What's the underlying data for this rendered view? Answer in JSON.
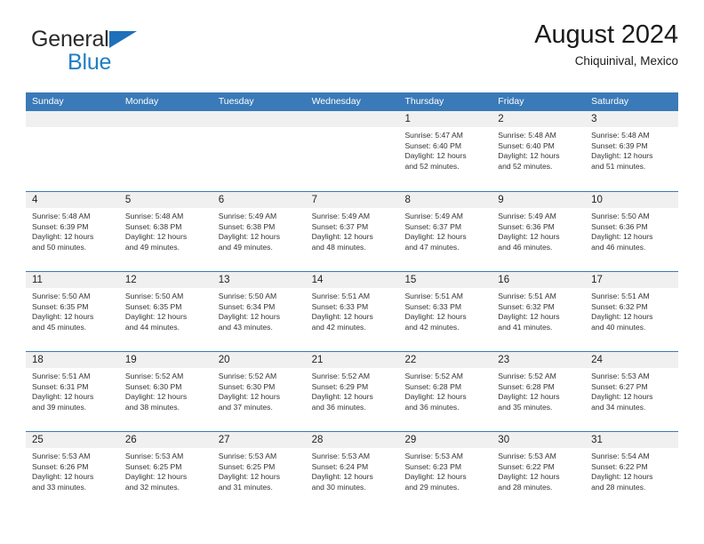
{
  "brand": {
    "name_part1": "General",
    "name_part2": "Blue",
    "triangle_color": "#1f6fba",
    "blue_color": "#1f7ec4"
  },
  "header": {
    "month_title": "August 2024",
    "location": "Chiquinival, Mexico"
  },
  "theme": {
    "header_blue": "#3a7ab8",
    "daynum_band": "#f0f0f0",
    "text": "#333333"
  },
  "weekday_headers": [
    "Sunday",
    "Monday",
    "Tuesday",
    "Wednesday",
    "Thursday",
    "Friday",
    "Saturday"
  ],
  "weeks": [
    [
      {
        "day": "",
        "empty": true
      },
      {
        "day": "",
        "empty": true
      },
      {
        "day": "",
        "empty": true
      },
      {
        "day": "",
        "empty": true
      },
      {
        "day": "1",
        "sunrise": "Sunrise: 5:47 AM",
        "sunset": "Sunset: 6:40 PM",
        "daylight_l1": "Daylight: 12 hours",
        "daylight_l2": "and 52 minutes."
      },
      {
        "day": "2",
        "sunrise": "Sunrise: 5:48 AM",
        "sunset": "Sunset: 6:40 PM",
        "daylight_l1": "Daylight: 12 hours",
        "daylight_l2": "and 52 minutes."
      },
      {
        "day": "3",
        "sunrise": "Sunrise: 5:48 AM",
        "sunset": "Sunset: 6:39 PM",
        "daylight_l1": "Daylight: 12 hours",
        "daylight_l2": "and 51 minutes."
      }
    ],
    [
      {
        "day": "4",
        "sunrise": "Sunrise: 5:48 AM",
        "sunset": "Sunset: 6:39 PM",
        "daylight_l1": "Daylight: 12 hours",
        "daylight_l2": "and 50 minutes."
      },
      {
        "day": "5",
        "sunrise": "Sunrise: 5:48 AM",
        "sunset": "Sunset: 6:38 PM",
        "daylight_l1": "Daylight: 12 hours",
        "daylight_l2": "and 49 minutes."
      },
      {
        "day": "6",
        "sunrise": "Sunrise: 5:49 AM",
        "sunset": "Sunset: 6:38 PM",
        "daylight_l1": "Daylight: 12 hours",
        "daylight_l2": "and 49 minutes."
      },
      {
        "day": "7",
        "sunrise": "Sunrise: 5:49 AM",
        "sunset": "Sunset: 6:37 PM",
        "daylight_l1": "Daylight: 12 hours",
        "daylight_l2": "and 48 minutes."
      },
      {
        "day": "8",
        "sunrise": "Sunrise: 5:49 AM",
        "sunset": "Sunset: 6:37 PM",
        "daylight_l1": "Daylight: 12 hours",
        "daylight_l2": "and 47 minutes."
      },
      {
        "day": "9",
        "sunrise": "Sunrise: 5:49 AM",
        "sunset": "Sunset: 6:36 PM",
        "daylight_l1": "Daylight: 12 hours",
        "daylight_l2": "and 46 minutes."
      },
      {
        "day": "10",
        "sunrise": "Sunrise: 5:50 AM",
        "sunset": "Sunset: 6:36 PM",
        "daylight_l1": "Daylight: 12 hours",
        "daylight_l2": "and 46 minutes."
      }
    ],
    [
      {
        "day": "11",
        "sunrise": "Sunrise: 5:50 AM",
        "sunset": "Sunset: 6:35 PM",
        "daylight_l1": "Daylight: 12 hours",
        "daylight_l2": "and 45 minutes."
      },
      {
        "day": "12",
        "sunrise": "Sunrise: 5:50 AM",
        "sunset": "Sunset: 6:35 PM",
        "daylight_l1": "Daylight: 12 hours",
        "daylight_l2": "and 44 minutes."
      },
      {
        "day": "13",
        "sunrise": "Sunrise: 5:50 AM",
        "sunset": "Sunset: 6:34 PM",
        "daylight_l1": "Daylight: 12 hours",
        "daylight_l2": "and 43 minutes."
      },
      {
        "day": "14",
        "sunrise": "Sunrise: 5:51 AM",
        "sunset": "Sunset: 6:33 PM",
        "daylight_l1": "Daylight: 12 hours",
        "daylight_l2": "and 42 minutes."
      },
      {
        "day": "15",
        "sunrise": "Sunrise: 5:51 AM",
        "sunset": "Sunset: 6:33 PM",
        "daylight_l1": "Daylight: 12 hours",
        "daylight_l2": "and 42 minutes."
      },
      {
        "day": "16",
        "sunrise": "Sunrise: 5:51 AM",
        "sunset": "Sunset: 6:32 PM",
        "daylight_l1": "Daylight: 12 hours",
        "daylight_l2": "and 41 minutes."
      },
      {
        "day": "17",
        "sunrise": "Sunrise: 5:51 AM",
        "sunset": "Sunset: 6:32 PM",
        "daylight_l1": "Daylight: 12 hours",
        "daylight_l2": "and 40 minutes."
      }
    ],
    [
      {
        "day": "18",
        "sunrise": "Sunrise: 5:51 AM",
        "sunset": "Sunset: 6:31 PM",
        "daylight_l1": "Daylight: 12 hours",
        "daylight_l2": "and 39 minutes."
      },
      {
        "day": "19",
        "sunrise": "Sunrise: 5:52 AM",
        "sunset": "Sunset: 6:30 PM",
        "daylight_l1": "Daylight: 12 hours",
        "daylight_l2": "and 38 minutes."
      },
      {
        "day": "20",
        "sunrise": "Sunrise: 5:52 AM",
        "sunset": "Sunset: 6:30 PM",
        "daylight_l1": "Daylight: 12 hours",
        "daylight_l2": "and 37 minutes."
      },
      {
        "day": "21",
        "sunrise": "Sunrise: 5:52 AM",
        "sunset": "Sunset: 6:29 PM",
        "daylight_l1": "Daylight: 12 hours",
        "daylight_l2": "and 36 minutes."
      },
      {
        "day": "22",
        "sunrise": "Sunrise: 5:52 AM",
        "sunset": "Sunset: 6:28 PM",
        "daylight_l1": "Daylight: 12 hours",
        "daylight_l2": "and 36 minutes."
      },
      {
        "day": "23",
        "sunrise": "Sunrise: 5:52 AM",
        "sunset": "Sunset: 6:28 PM",
        "daylight_l1": "Daylight: 12 hours",
        "daylight_l2": "and 35 minutes."
      },
      {
        "day": "24",
        "sunrise": "Sunrise: 5:53 AM",
        "sunset": "Sunset: 6:27 PM",
        "daylight_l1": "Daylight: 12 hours",
        "daylight_l2": "and 34 minutes."
      }
    ],
    [
      {
        "day": "25",
        "sunrise": "Sunrise: 5:53 AM",
        "sunset": "Sunset: 6:26 PM",
        "daylight_l1": "Daylight: 12 hours",
        "daylight_l2": "and 33 minutes."
      },
      {
        "day": "26",
        "sunrise": "Sunrise: 5:53 AM",
        "sunset": "Sunset: 6:25 PM",
        "daylight_l1": "Daylight: 12 hours",
        "daylight_l2": "and 32 minutes."
      },
      {
        "day": "27",
        "sunrise": "Sunrise: 5:53 AM",
        "sunset": "Sunset: 6:25 PM",
        "daylight_l1": "Daylight: 12 hours",
        "daylight_l2": "and 31 minutes."
      },
      {
        "day": "28",
        "sunrise": "Sunrise: 5:53 AM",
        "sunset": "Sunset: 6:24 PM",
        "daylight_l1": "Daylight: 12 hours",
        "daylight_l2": "and 30 minutes."
      },
      {
        "day": "29",
        "sunrise": "Sunrise: 5:53 AM",
        "sunset": "Sunset: 6:23 PM",
        "daylight_l1": "Daylight: 12 hours",
        "daylight_l2": "and 29 minutes."
      },
      {
        "day": "30",
        "sunrise": "Sunrise: 5:53 AM",
        "sunset": "Sunset: 6:22 PM",
        "daylight_l1": "Daylight: 12 hours",
        "daylight_l2": "and 28 minutes."
      },
      {
        "day": "31",
        "sunrise": "Sunrise: 5:54 AM",
        "sunset": "Sunset: 6:22 PM",
        "daylight_l1": "Daylight: 12 hours",
        "daylight_l2": "and 28 minutes."
      }
    ]
  ]
}
